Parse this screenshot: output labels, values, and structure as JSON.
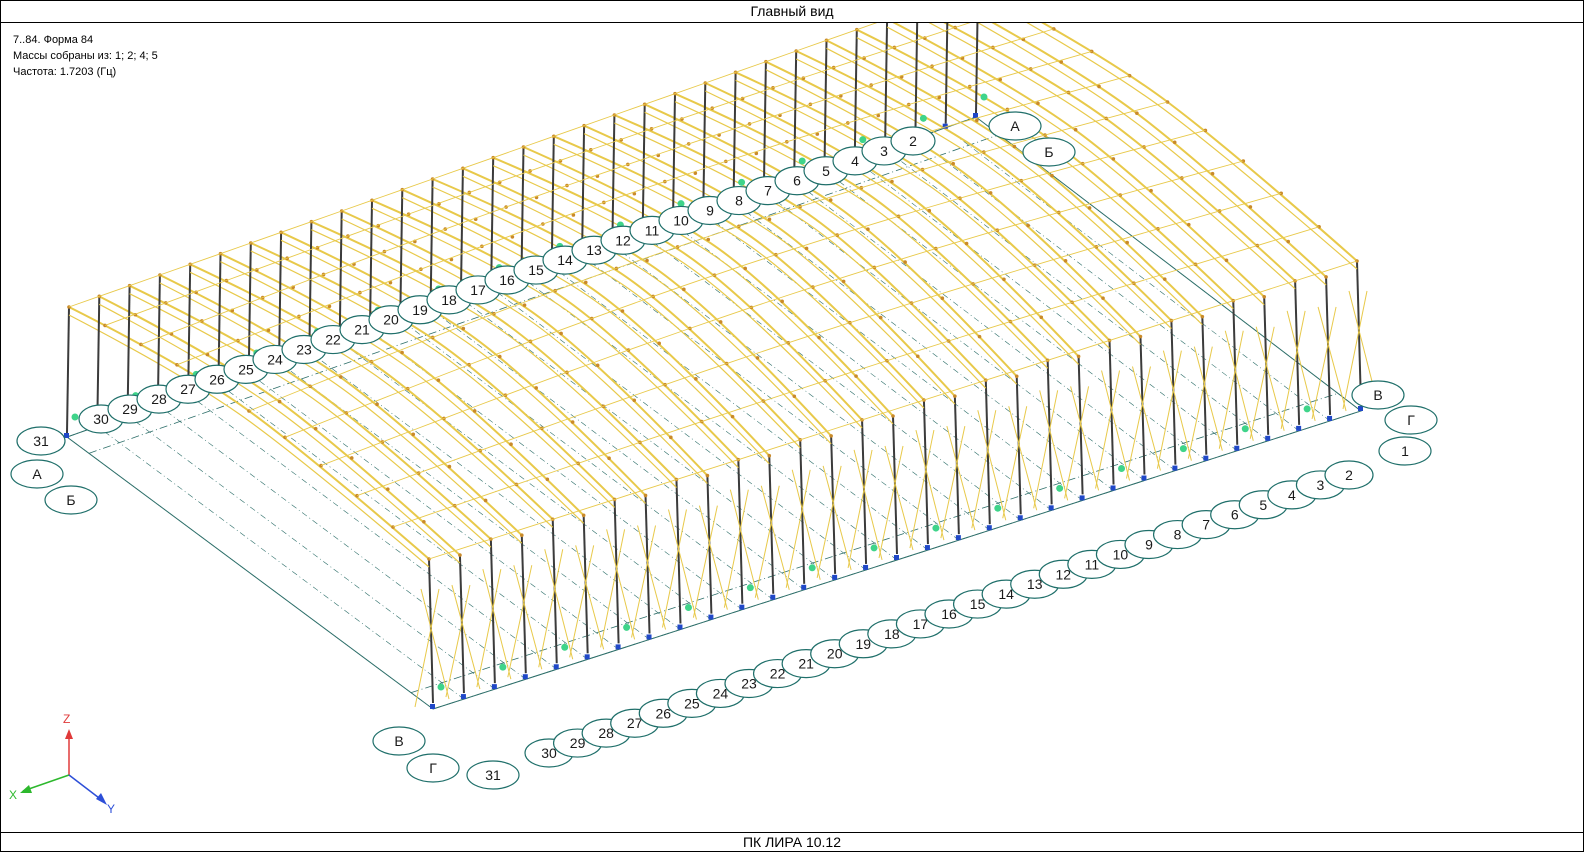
{
  "window": {
    "title": "Главный вид",
    "footer": "ПК ЛИРА 10.12"
  },
  "info": {
    "line1": "7..84. Форма 84",
    "line2": "Массы собраны из: 1; 2; 4; 5",
    "line3": "Частота: 1.7203 (Гц)"
  },
  "axes": {
    "x_label": "X",
    "y_label": "Y",
    "z_label": "Z",
    "x_color": "#2db82d",
    "y_color": "#2d4fd8",
    "z_color": "#e03a3a"
  },
  "grid_bubbles": {
    "front_row_numbers": [
      "30",
      "29",
      "28",
      "27",
      "26",
      "25",
      "24",
      "23",
      "22",
      "21",
      "20",
      "19",
      "18",
      "17",
      "16",
      "15",
      "14",
      "13",
      "12",
      "11",
      "10",
      "9",
      "8",
      "7",
      "6",
      "5",
      "4",
      "3",
      "2"
    ],
    "back_row_numbers": [
      "30",
      "29",
      "28",
      "27",
      "26",
      "25",
      "24",
      "23",
      "22",
      "21",
      "20",
      "19",
      "18",
      "17",
      "16",
      "15",
      "14",
      "13",
      "12",
      "11",
      "10",
      "9",
      "8",
      "7",
      "6",
      "5",
      "4",
      "3",
      "2"
    ],
    "left_end_number": "31",
    "bottom_left_number": "31",
    "right_end_number": "1",
    "letters_left": [
      "А",
      "Б"
    ],
    "letters_bottom": [
      "В",
      "Г"
    ],
    "letters_top_right": [
      "А",
      "Б"
    ],
    "letters_right": [
      "В",
      "Г"
    ],
    "bubble_stroke": "#1f6f6a"
  },
  "colors": {
    "frame_members": "#e8c94a",
    "columns": "#3b3b3b",
    "nodes": "#c98a2a",
    "supports": "#2048c8",
    "support_highlight": "#3fd48a",
    "grid_lines": "#2e6f6a"
  }
}
